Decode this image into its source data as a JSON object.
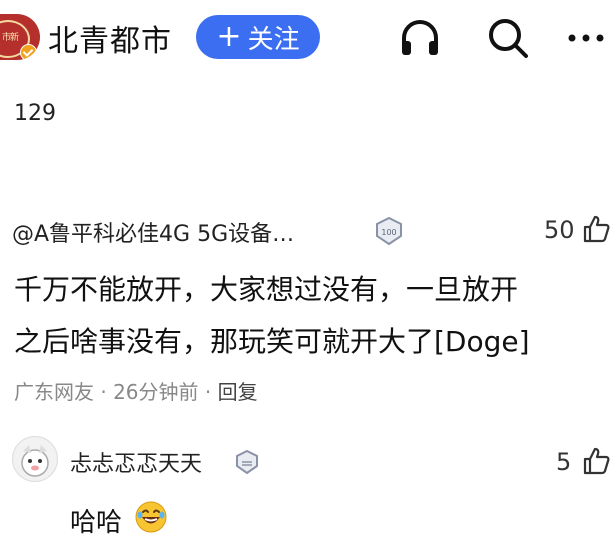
{
  "header": {
    "account_name": "北青都市",
    "follow_label": "关注",
    "follow_plus": "+",
    "icons": [
      "headphones-icon",
      "search-icon",
      "more-icon"
    ],
    "accent_color": "#3b6ef0"
  },
  "count_line": "129",
  "comment": {
    "user": "@A鲁平科必佳4G 5G设备…",
    "badge_text": "100",
    "likes": "50",
    "lines": [
      "千万不能放开，大家想过没有，一旦放开",
      "之后啥事没有，那玩笑可就开大了[Doge]"
    ],
    "location": "广东网友",
    "separator": "·",
    "time": "26分钟前",
    "reply_label": "回复"
  },
  "reply": {
    "user": "忐忐忑忑天天",
    "likes": "5",
    "text": "哈哈"
  }
}
